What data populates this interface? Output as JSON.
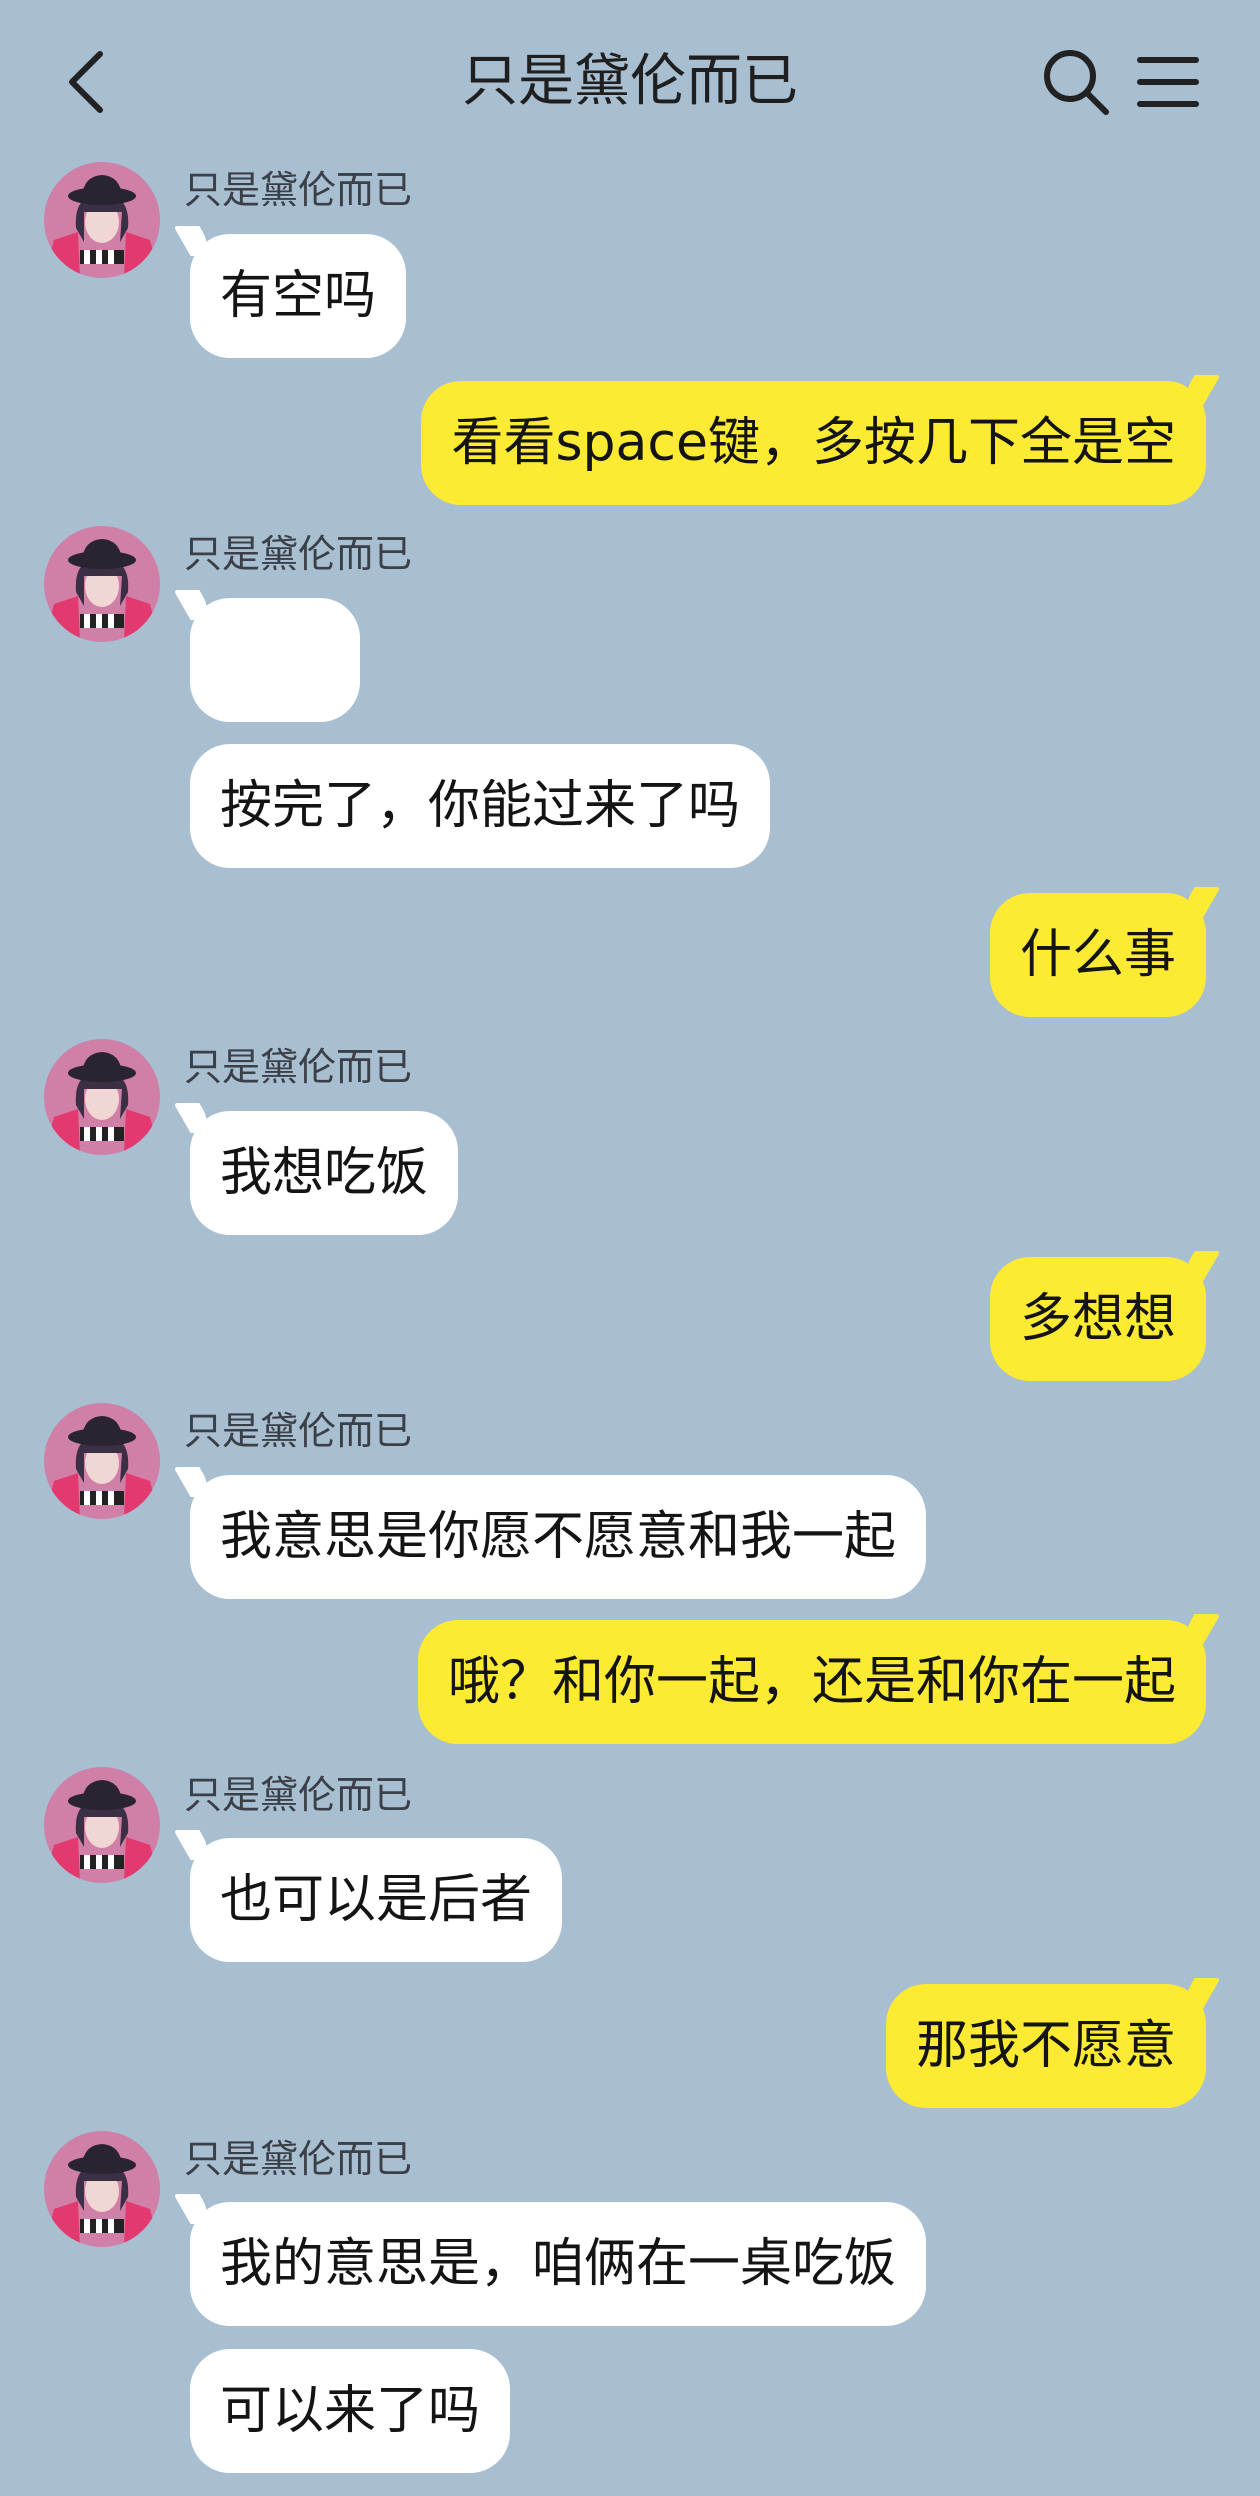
{
  "header": {
    "title": "只是黛伦而已",
    "back_icon": "chevron-left-icon",
    "search_icon": "search-icon",
    "menu_icon": "menu-icon"
  },
  "colors": {
    "background": "#a8bed1",
    "incoming_bubble": "#ffffff",
    "outgoing_bubble": "#fdea32"
  },
  "messages": [
    {
      "from": "other",
      "sender": "只是黛伦而已",
      "text": "有空吗"
    },
    {
      "from": "me",
      "text": "看看space键，多按几下全是空"
    },
    {
      "from": "other",
      "sender": "只是黛伦而已",
      "text": ""
    },
    {
      "from": "other",
      "text": "按完了，你能过来了吗"
    },
    {
      "from": "me",
      "text": "什么事"
    },
    {
      "from": "other",
      "sender": "只是黛伦而已",
      "text": "我想吃饭"
    },
    {
      "from": "me",
      "text": "多想想"
    },
    {
      "from": "other",
      "sender": "只是黛伦而已",
      "text": "我意思是你愿不愿意和我一起"
    },
    {
      "from": "me",
      "text": "哦？和你一起，还是和你在一起"
    },
    {
      "from": "other",
      "sender": "只是黛伦而已",
      "text": "也可以是后者"
    },
    {
      "from": "me",
      "text": "那我不愿意"
    },
    {
      "from": "other",
      "sender": "只是黛伦而已",
      "text": "我的意思是，咱俩在一桌吃饭"
    },
    {
      "from": "other",
      "text": "可以来了吗"
    }
  ]
}
